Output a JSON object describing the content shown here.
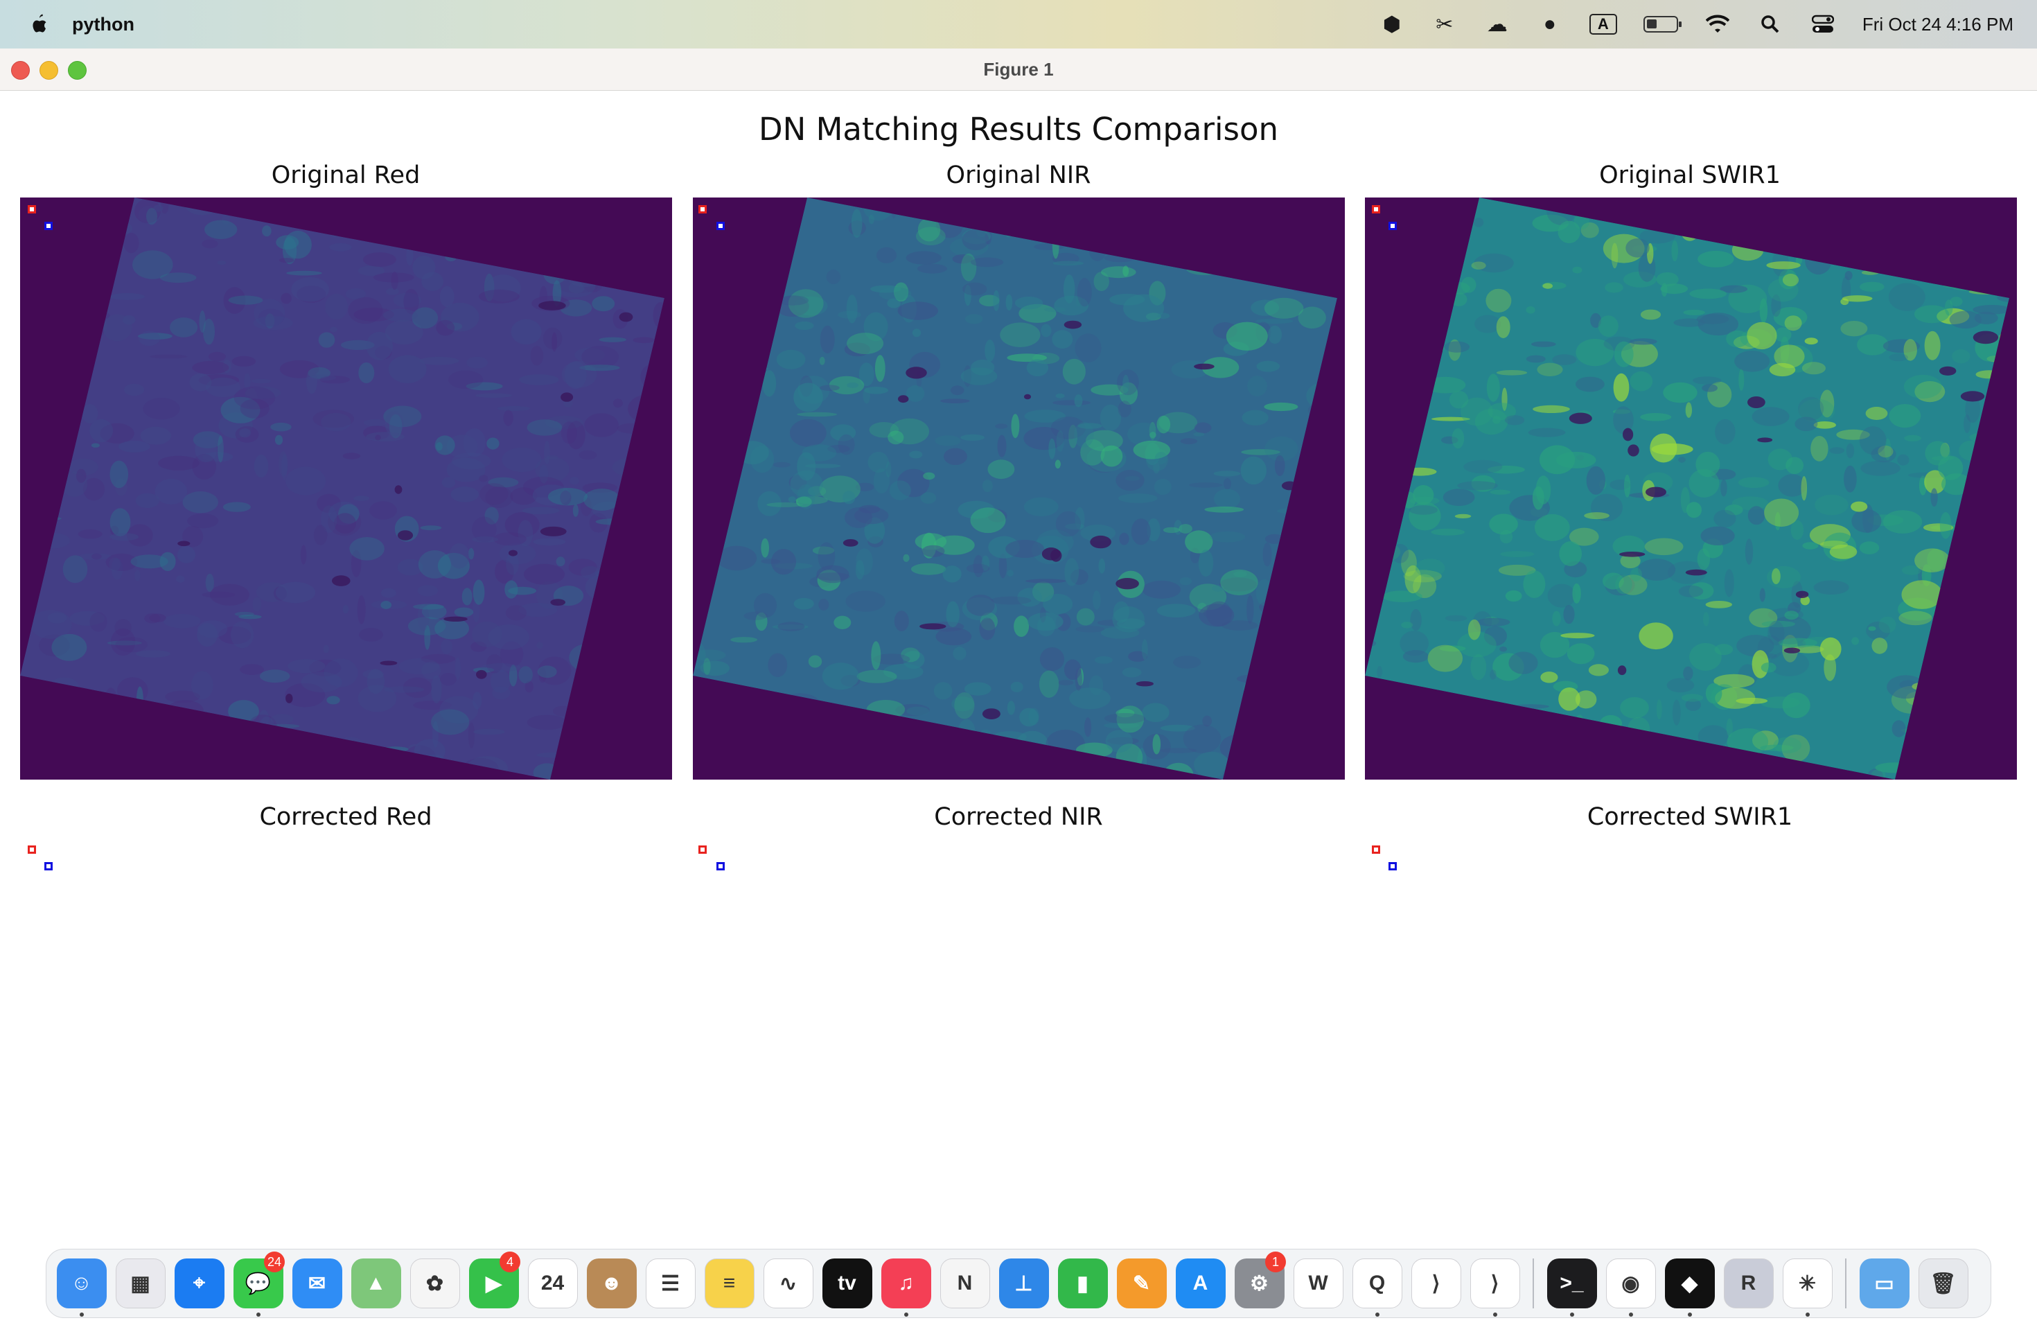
{
  "menubar": {
    "app_name": "python",
    "clock": "Fri Oct 24  4:16 PM",
    "input_source": "A",
    "icons": [
      "box-icon",
      "tools-icon",
      "creative-cloud-icon",
      "user-icon",
      "input-source-icon",
      "battery-icon",
      "wifi-icon",
      "search-icon",
      "control-center-icon"
    ]
  },
  "window": {
    "title": "Figure 1"
  },
  "figure": {
    "suptitle": "DN Matching Results Comparison",
    "panels": [
      {
        "title": "Original Red",
        "band": "red",
        "rendered": true
      },
      {
        "title": "Original NIR",
        "band": "nir",
        "rendered": true
      },
      {
        "title": "Original SWIR1",
        "band": "swir1",
        "rendered": true
      },
      {
        "title": "Corrected Red",
        "band": "red",
        "rendered": false
      },
      {
        "title": "Corrected NIR",
        "band": "nir",
        "rendered": false
      },
      {
        "title": "Corrected SWIR1",
        "band": "swir1",
        "rendered": false
      }
    ],
    "marker_colors": {
      "a": "#e8231f",
      "b": "#1010e0"
    },
    "nodata_color": "#440a55"
  },
  "dock": {
    "apps": [
      {
        "name": "finder-icon",
        "bg": "#3b8ef0",
        "glyph": "☺",
        "dot": true
      },
      {
        "name": "launchpad-icon",
        "bg": "#e9e9ee",
        "glyph": "▦",
        "dot": false
      },
      {
        "name": "safari-icon",
        "bg": "#1b7cf2",
        "glyph": "⌖",
        "dot": false
      },
      {
        "name": "messages-icon",
        "bg": "#38c94b",
        "glyph": "💬",
        "badge": "24",
        "dot": true
      },
      {
        "name": "mail-icon",
        "bg": "#2f8df5",
        "glyph": "✉",
        "dot": false
      },
      {
        "name": "maps-icon",
        "bg": "#7ec77a",
        "glyph": "▲",
        "dot": false
      },
      {
        "name": "photos-icon",
        "bg": "#f5f5f5",
        "glyph": "✿",
        "dot": false
      },
      {
        "name": "facetime-icon",
        "bg": "#35c14a",
        "glyph": "▶",
        "badge": "4",
        "dot": false
      },
      {
        "name": "calendar-icon",
        "bg": "#ffffff",
        "glyph": "24",
        "dot": false
      },
      {
        "name": "contacts-icon",
        "bg": "#b98a56",
        "glyph": "☻",
        "dot": false
      },
      {
        "name": "reminders-icon",
        "bg": "#ffffff",
        "glyph": "☰",
        "dot": false
      },
      {
        "name": "notes-icon",
        "bg": "#f7d24a",
        "glyph": "≡",
        "dot": false
      },
      {
        "name": "freeform-icon",
        "bg": "#ffffff",
        "glyph": "∿",
        "dot": false
      },
      {
        "name": "apple-tv-icon",
        "bg": "#111111",
        "glyph": "tv",
        "dot": false
      },
      {
        "name": "music-icon",
        "bg": "#f43f55",
        "glyph": "♫",
        "dot": true
      },
      {
        "name": "news-icon",
        "bg": "#f5f5f5",
        "glyph": "N",
        "dot": false
      },
      {
        "name": "keynote-icon",
        "bg": "#2e87e8",
        "glyph": "⊥",
        "dot": false
      },
      {
        "name": "numbers-icon",
        "bg": "#32b84a",
        "glyph": "▮",
        "dot": false
      },
      {
        "name": "pages-icon",
        "bg": "#f49a2b",
        "glyph": "✎",
        "dot": false
      },
      {
        "name": "app-store-icon",
        "bg": "#1f8cf3",
        "glyph": "A",
        "dot": false
      },
      {
        "name": "system-settings-icon",
        "bg": "#8a8d93",
        "glyph": "⚙",
        "badge": "1",
        "dot": false
      },
      {
        "name": "word-icon",
        "bg": "#ffffff",
        "glyph": "W",
        "dot": false
      },
      {
        "name": "qgis-icon",
        "bg": "#ffffff",
        "glyph": "Q",
        "dot": true
      },
      {
        "name": "vscode-icon",
        "bg": "#ffffff",
        "glyph": "⟩",
        "dot": false
      },
      {
        "name": "vscode-insiders-icon",
        "bg": "#ffffff",
        "glyph": "⟩",
        "dot": true
      }
    ],
    "apps_right": [
      {
        "name": "terminal-icon",
        "bg": "#1c1c1e",
        "glyph": ">_",
        "dot": true
      },
      {
        "name": "chrome-icon",
        "bg": "#ffffff",
        "glyph": "◉",
        "dot": true
      },
      {
        "name": "cube-app-icon",
        "bg": "#111111",
        "glyph": "◆",
        "dot": true
      },
      {
        "name": "r-icon",
        "bg": "#c9ccd8",
        "glyph": "R",
        "dot": false
      },
      {
        "name": "python-launcher-icon",
        "bg": "#ffffff",
        "glyph": "✳",
        "dot": true
      }
    ],
    "apps_end": [
      {
        "name": "downloads-folder-icon",
        "bg": "#5fa8ea",
        "glyph": "▭",
        "dot": false
      },
      {
        "name": "trash-icon",
        "bg": "#e6e8ec",
        "glyph": "🗑",
        "dot": false
      }
    ]
  }
}
